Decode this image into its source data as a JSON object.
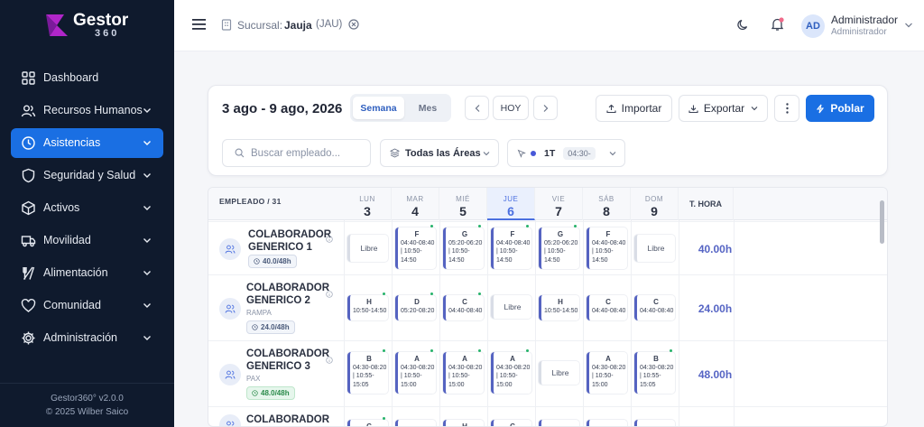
{
  "brand": {
    "name": "Gestor",
    "sub": "360"
  },
  "nav": [
    {
      "label": "Dashboard",
      "icon": "dashboard-icon",
      "chevron": false,
      "active": false
    },
    {
      "label": "Recursos Humanos",
      "icon": "users-icon",
      "chevron": true,
      "active": false
    },
    {
      "label": "Asistencias",
      "icon": "clock-icon",
      "chevron": true,
      "active": true
    },
    {
      "label": "Seguridad y Salud",
      "icon": "shield-icon",
      "chevron": true,
      "active": false
    },
    {
      "label": "Activos",
      "icon": "cube-icon",
      "chevron": true,
      "active": false
    },
    {
      "label": "Movilidad",
      "icon": "truck-icon",
      "chevron": true,
      "active": false
    },
    {
      "label": "Alimentación",
      "icon": "utensils-icon",
      "chevron": true,
      "active": false
    },
    {
      "label": "Comunidad",
      "icon": "heart-icon",
      "chevron": true,
      "active": false
    },
    {
      "label": "Administración",
      "icon": "gear-icon",
      "chevron": true,
      "active": false
    }
  ],
  "footer": {
    "version": "Gestor360° v2.0.0",
    "copyright": "© 2025 Wilber Saico"
  },
  "topbar": {
    "branch_label": "Sucursal:",
    "branch_name": "Jauja",
    "branch_code": "(JAU)",
    "user_name": "Administrador",
    "user_role": "Administrador",
    "user_initials": "AD"
  },
  "toolbar": {
    "range": "3 ago - 9 ago, 2026",
    "view_week": "Semana",
    "view_month": "Mes",
    "today": "HOY",
    "import": "Importar",
    "export": "Exportar",
    "populate": "Poblar"
  },
  "filters": {
    "search_placeholder": "Buscar empleado...",
    "area": "Todas las Áreas",
    "shift_code": "1T",
    "shift_time": "04:30-"
  },
  "grid": {
    "employee_header": "EMPLEADO / 31",
    "total_header": "T. HORA",
    "days": [
      {
        "name": "LUN",
        "num": "3"
      },
      {
        "name": "MAR",
        "num": "4"
      },
      {
        "name": "MIÉ",
        "num": "5"
      },
      {
        "name": "JUE",
        "num": "6"
      },
      {
        "name": "VIE",
        "num": "7"
      },
      {
        "name": "SÁB",
        "num": "8"
      },
      {
        "name": "DOM",
        "num": "9"
      }
    ],
    "rows": [
      {
        "name1": "COLABORADOR",
        "name2": "GENERICO 1",
        "area": "",
        "badge": "40.0/48h",
        "total": "40.00h",
        "shifts": [
          {
            "free": true,
            "label": "Libre"
          },
          {
            "code": "F",
            "time": "04:40-08:40 | 10:50-14:50",
            "dot": true
          },
          {
            "code": "G",
            "time": "05:20-06:20 | 10:50-14:50",
            "dot": true
          },
          {
            "code": "F",
            "time": "04:40-08:40 | 10:50-14:50",
            "dot": true
          },
          {
            "code": "G",
            "time": "05:20-06:20 | 10:50-14:50",
            "dot": true
          },
          {
            "code": "F",
            "time": "04:40-08:40 | 10:50-14:50",
            "dot": false
          },
          {
            "free": true,
            "label": "Libre"
          }
        ]
      },
      {
        "name1": "COLABORADOR",
        "name2": "GENERICO 2",
        "area": "RAMPA",
        "badge": "24.0/48h",
        "total": "24.00h",
        "shifts": [
          {
            "code": "H",
            "time": "10:50-14:50",
            "dot": true
          },
          {
            "code": "D",
            "time": "05:20-08:20",
            "dot": true
          },
          {
            "code": "C",
            "time": "04:40-08:40",
            "dot": true
          },
          {
            "free": true,
            "label": "Libre"
          },
          {
            "code": "H",
            "time": "10:50-14:50",
            "dot": false
          },
          {
            "code": "C",
            "time": "04:40-08:40",
            "dot": false
          },
          {
            "code": "C",
            "time": "04:40-08:40",
            "dot": false
          }
        ]
      },
      {
        "name1": "COLABORADOR",
        "name2": "GENERICO 3",
        "area": "PAX",
        "badge": "48.0/48h",
        "total": "48.00h",
        "shifts": [
          {
            "code": "B",
            "time": "04:30-08:20 | 10:55-15:05",
            "dot": true
          },
          {
            "code": "A",
            "time": "04:30-08:20 | 10:50-15:00",
            "dot": true
          },
          {
            "code": "A",
            "time": "04:30-08:20 | 10:50-15:00",
            "dot": true
          },
          {
            "code": "A",
            "time": "04:30-08:20 | 10:50-15:00",
            "dot": true
          },
          {
            "free": true,
            "label": "Libre"
          },
          {
            "code": "A",
            "time": "04:30-08:20 | 10:50-15:00",
            "dot": false
          },
          {
            "code": "B",
            "time": "04:30-08:20 | 10:55-15:05",
            "dot": true
          }
        ]
      },
      {
        "name1": "COLABORADOR",
        "name2": "",
        "area": "",
        "badge": "",
        "total": "",
        "shifts": [
          {
            "code": "C",
            "time": "",
            "dot": true
          },
          {
            "code": "",
            "time": "",
            "dot": false
          },
          {
            "code": "H",
            "time": "",
            "dot": false
          },
          {
            "code": "C",
            "time": "",
            "dot": false
          },
          {
            "code": "",
            "time": "",
            "dot": false
          },
          {
            "code": "",
            "time": "",
            "dot": false
          },
          {
            "code": "",
            "time": "",
            "dot": false
          }
        ]
      }
    ]
  }
}
